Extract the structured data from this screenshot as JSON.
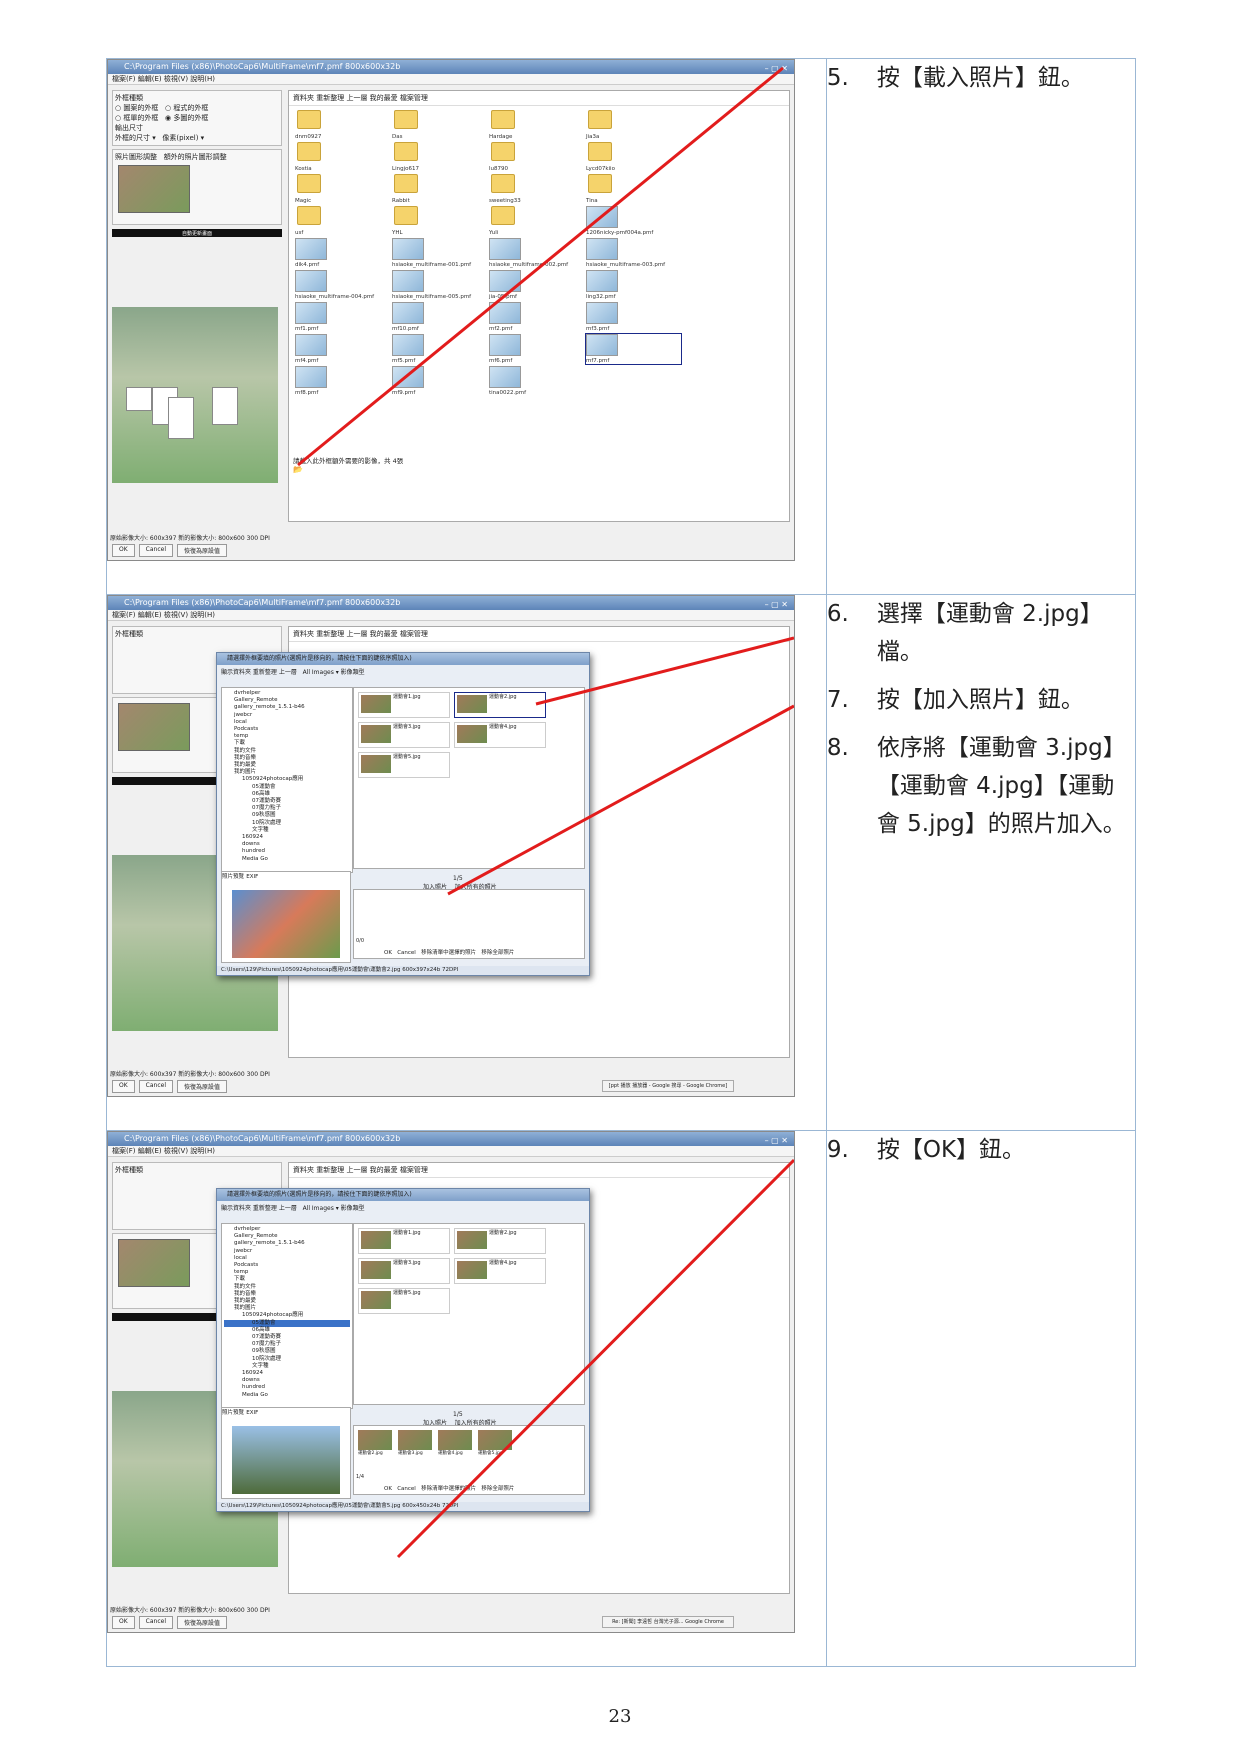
{
  "steps": [
    {
      "id": "row1",
      "items": [
        {
          "num": "5.",
          "text": "按【載入照片】鈕。"
        }
      ]
    },
    {
      "id": "row2",
      "items": [
        {
          "num": "6.",
          "text": "選擇【運動會 2.jpg】檔。"
        },
        {
          "num": "7.",
          "text": "按【加入照片】鈕。"
        },
        {
          "num": "8.",
          "text": "依序將【運動會 3.jpg】【運動會 4.jpg】【運動會 5.jpg】的照片加入。"
        }
      ]
    },
    {
      "id": "row3",
      "items": [
        {
          "num": "9.",
          "text": "按【OK】鈕。"
        }
      ]
    }
  ],
  "screenshot": {
    "title": "C:\\Program Files (x86)\\PhotoCap6\\MultiFrame\\mf7.pmf  800x600x32b",
    "menu": "檔案(F)  編輯(E)  檢視(V)  說明(H)",
    "left": {
      "frame_type_label": "外框種類",
      "opt1": "圖案的外框",
      "opt2": "程式的外框",
      "opt3": "框單的外框",
      "opt4": "多圖的外框",
      "output_label": "輸出尺寸",
      "output_value": "外框的尺寸",
      "unit_value": "像素(pixel)",
      "photo_adjust": "照片圖形調整",
      "extra_adjust": "額外的照片圖形調整",
      "auto_update": "自動更新畫面"
    },
    "toolbar": "資料夾    重新整理    上一層    我的最愛    檔案管理",
    "folders": [
      "dnm0927",
      "Das",
      "Hardage",
      "Jia3a",
      "Kostia",
      "Lingjo617",
      "lu8790",
      "Lycd07kiio",
      "Magic",
      "Rabbit",
      "sweeting33",
      "Tina",
      "usf",
      "YHL",
      "Yuli"
    ],
    "files": [
      "1206nicky-pmf004a.pmf",
      "dik4.pmf",
      "hsiaoke_multiframe-001.pmf",
      "hsiaoke_multiframe-002.pmf",
      "hsiaoke_multiframe-003.pmf",
      "hsiaoke_multiframe-004.pmf",
      "hsiaoke_multiframe-005.pmf",
      "jia-05.pmf",
      "ling32.pmf",
      "mf1.pmf",
      "mf10.pmf",
      "mf2.pmf",
      "mf3.pmf",
      "mf4.pmf",
      "mf5.pmf",
      "mf6.pmf",
      "mf7.pmf",
      "mf8.pmf",
      "mf9.pmf",
      "tina0022.pmf"
    ],
    "hint": "請載入此外框額外需要的影像，共 4張",
    "status": "原始影像大小: 600x397   新的影像大小: 800x600 300 DPI",
    "ok": "OK",
    "cancel": "Cancel",
    "reset": "恢復為原設值",
    "dialog": {
      "title": "請選擇外框要填的照片(選照片是移向的，請按住下面的鍵依序照加入)",
      "toolbar": "顯示資料夾    重新整理    上一層",
      "filter": "All Images",
      "filter_label": "影像類型",
      "tree": [
        "dvrhelper",
        "Gallery_Remote",
        "gallery_remote_1.5.1-b46",
        "jwebcr",
        "local",
        "Podcasts",
        "temp",
        "下載",
        "我的文件",
        "我的音樂",
        "我的最愛",
        "我的圖片",
        "1050924photocap應用",
        "05運動會",
        "06高雄",
        "07運動奇賽",
        "07魔力點子",
        "09秋感圖",
        "10院次處理",
        "文字種",
        "160924",
        "downs",
        "hundred",
        "Media Go"
      ],
      "thumbs": [
        "運動會1.jpg",
        "運動會2.jpg",
        "運動會3.jpg",
        "運動會4.jpg",
        "運動會5.jpg"
      ],
      "add_one": "加入照片",
      "add_all": "加入所有的照片",
      "counter1": "0/0",
      "counter2": "1/5",
      "counter3": "1/4",
      "remove_sel": "移除清單中選擇的照片",
      "remove_all": "移除全部照片",
      "preview_tab": "照片預覽",
      "exif_tab": "EXIF",
      "path": "C:\\Users\\129\\Pictures\\1050924photocap應用\\05運動會\\運動會2.jpg  600x397x24b  72DPI",
      "path3": "C:\\Users\\129\\Pictures\\1050924photocap應用\\05運動會\\運動會5.jpg  600x450x24b  72DPI"
    },
    "taskbar2": "[ppt 播放 播放器 - Google 搜尋 - Google Chrome]",
    "taskbar3": "Re: [新聞] 李遠哲 台灣光子源... Google Chrome"
  },
  "page_number": "23",
  "colors": {
    "table_border": "#9bb7d4",
    "arrow": "#e21c1c"
  }
}
